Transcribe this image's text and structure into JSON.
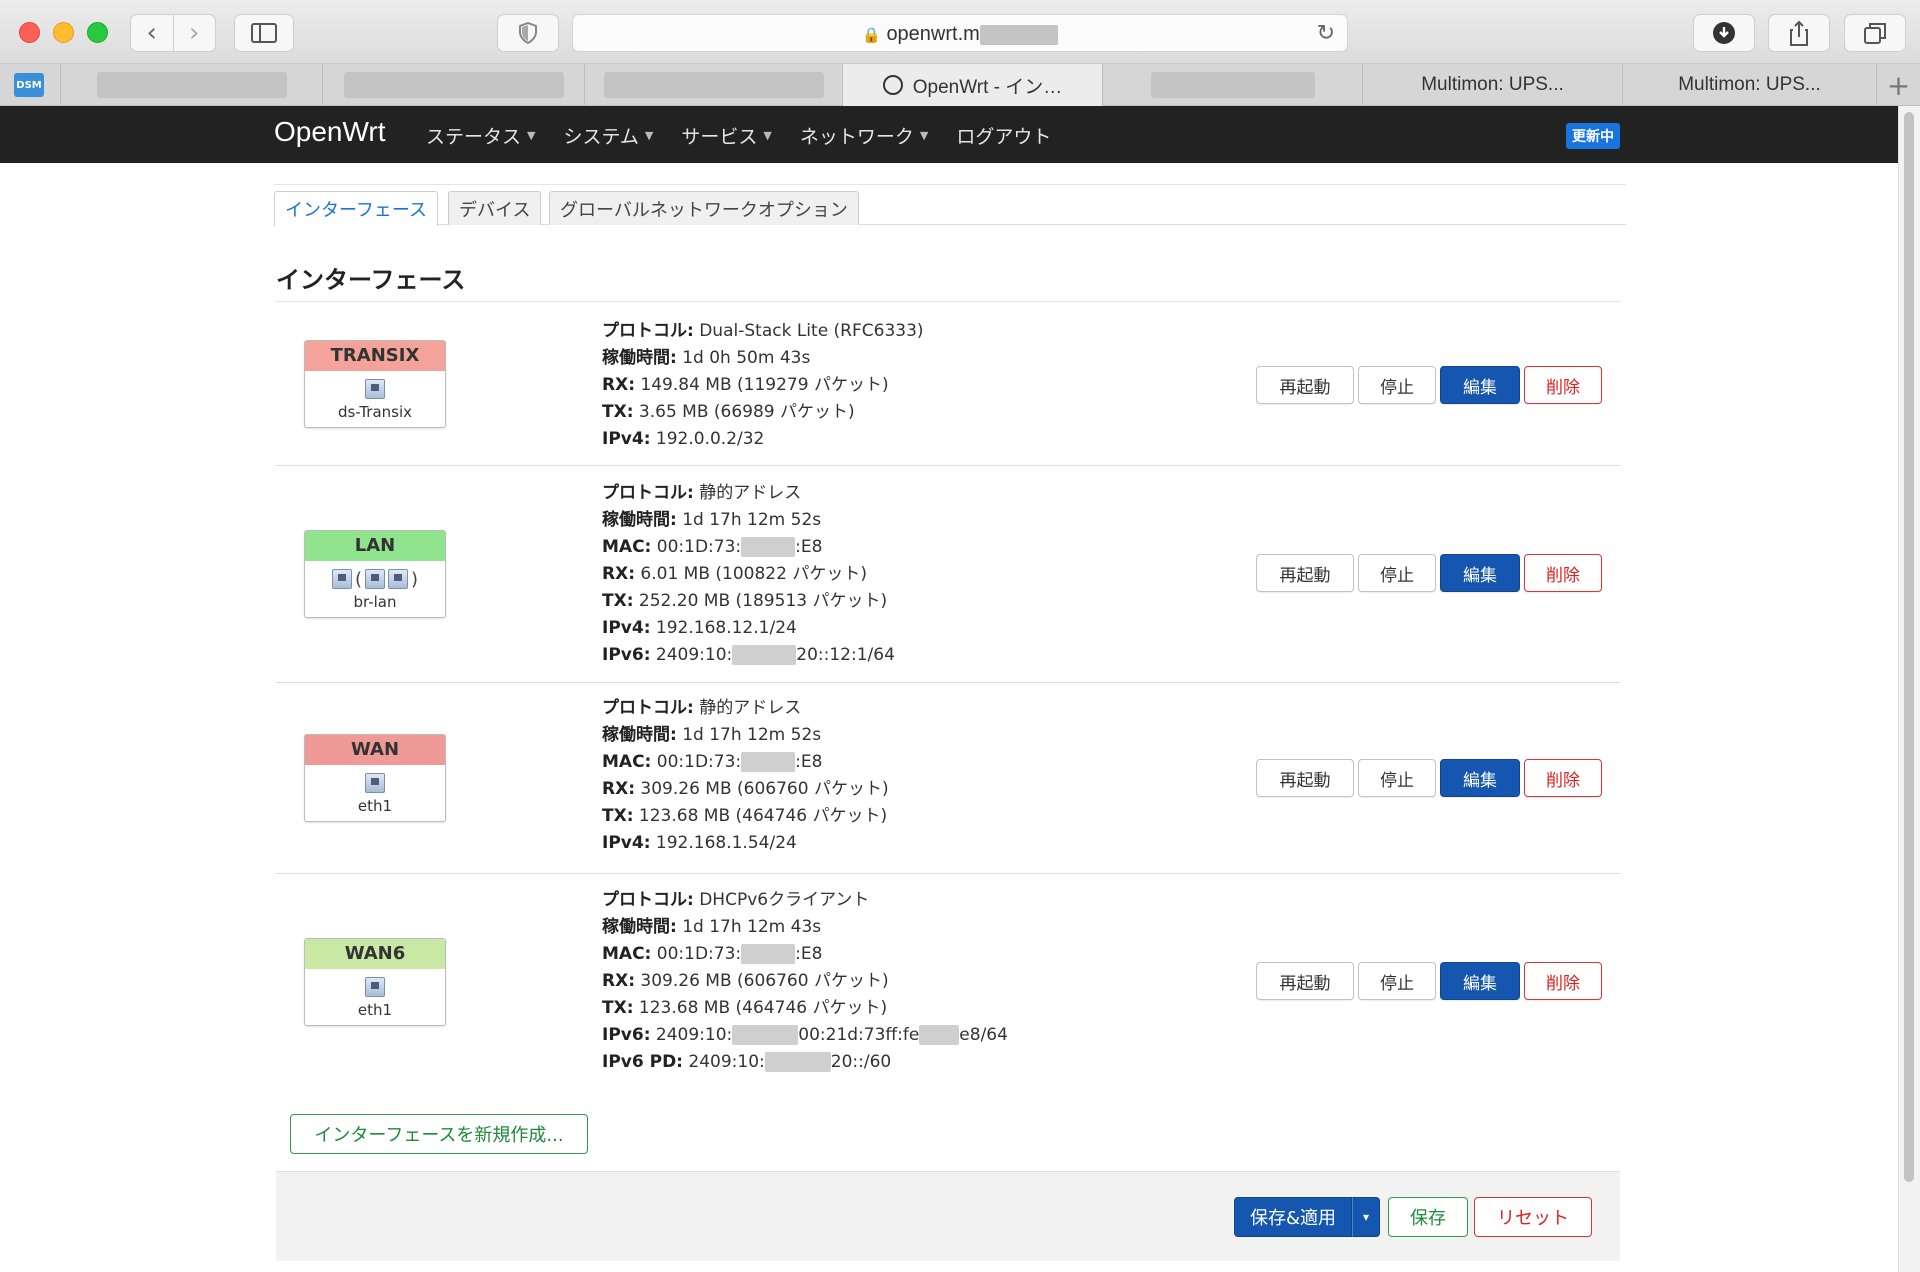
{
  "browser": {
    "url": "openwrt.m",
    "tabs": [
      {
        "label": "",
        "blurred": true
      },
      {
        "label": "",
        "blurred": true
      },
      {
        "label": "",
        "blurred": true
      },
      {
        "label": "OpenWrt - イン…",
        "active": true
      },
      {
        "label": "",
        "blurred": true
      },
      {
        "label": "Multimon: UPS..."
      },
      {
        "label": "Multimon: UPS..."
      }
    ],
    "dsm_label": "DSM",
    "new_tab": "+"
  },
  "header": {
    "brand": "OpenWrt",
    "menu": [
      "ステータス",
      "システム",
      "サービス",
      "ネットワーク",
      "ログアウト"
    ],
    "status_badge": "更新中"
  },
  "tabs": [
    "インターフェース",
    "デバイス",
    "グローバルネットワークオプション"
  ],
  "page_title": "インターフェース",
  "buttons": {
    "restart": "再起動",
    "stop": "停止",
    "edit": "編集",
    "delete": "削除"
  },
  "labels": {
    "protocol": "プロトコル:",
    "uptime": "稼働時間:",
    "mac": "MAC:",
    "rx": "RX:",
    "tx": "TX:",
    "ipv4": "IPv4:",
    "ipv6": "IPv6:",
    "ipv6pd": "IPv6 PD:"
  },
  "interfaces": [
    {
      "name": "TRANSIX",
      "color": "#f4a39a",
      "device": "ds-Transix",
      "protocol": "Dual-Stack Lite (RFC6333)",
      "uptime": "1d 0h 50m 43s",
      "rx": "149.84 MB (119279 パケット)",
      "tx": "3.65 MB (66989 パケット)",
      "ipv4": "192.0.0.2/32"
    },
    {
      "name": "LAN",
      "color": "#90e48e",
      "device": "br-lan",
      "protocol": "静的アドレス",
      "uptime": "1d 17h 12m 52s",
      "mac_prefix": "00:1D:73:",
      "mac_suffix": ":E8",
      "rx": "6.01 MB (100822 パケット)",
      "tx": "252.20 MB (189513 パケット)",
      "ipv4": "192.168.12.1/24",
      "ipv6_prefix": "2409:10:",
      "ipv6_suffix": "20::12:1/64"
    },
    {
      "name": "WAN",
      "color": "#f09a98",
      "device": "eth1",
      "protocol": "静的アドレス",
      "uptime": "1d 17h 12m 52s",
      "mac_prefix": "00:1D:73:",
      "mac_suffix": ":E8",
      "rx": "309.26 MB (606760 パケット)",
      "tx": "123.68 MB (464746 パケット)",
      "ipv4": "192.168.1.54/24"
    },
    {
      "name": "WAN6",
      "color": "#c9e8a4",
      "device": "eth1",
      "protocol": "DHCPv6クライアント",
      "uptime": "1d 17h 12m 43s",
      "mac_prefix": "00:1D:73:",
      "mac_suffix": ":E8",
      "rx": "309.26 MB (606760 パケット)",
      "tx": "123.68 MB (464746 パケット)",
      "ipv6_prefix": "2409:10:",
      "ipv6_mid": "00:21d:73ff:fe",
      "ipv6_suffix": "e8/64",
      "ipv6pd_prefix": "2409:10:",
      "ipv6pd_suffix": "20::/60"
    }
  ],
  "new_interface": "インターフェースを新規作成...",
  "footer": {
    "save_apply": "保存&適用",
    "caret": "▾",
    "save": "保存",
    "reset": "リセット"
  }
}
